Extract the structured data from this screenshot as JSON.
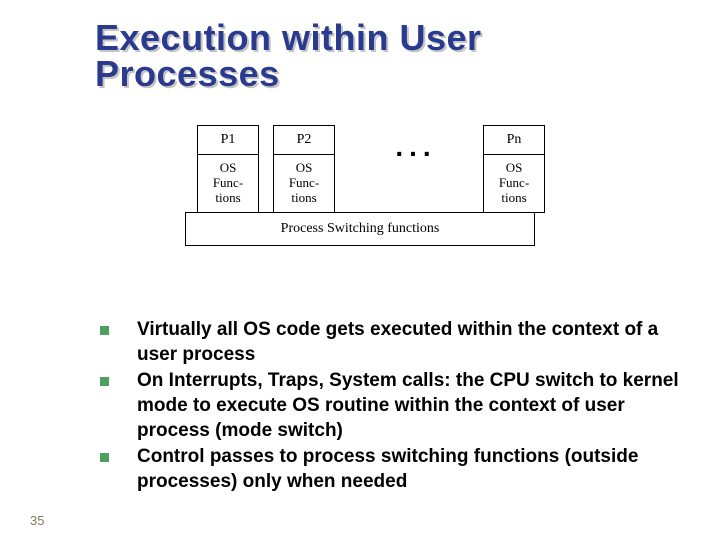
{
  "title_line1": "Execution within User",
  "title_line2": "Processes",
  "diagram": {
    "p1": "P1",
    "p2": "P2",
    "pn": "Pn",
    "ellipsis": "...",
    "os_line1": "OS",
    "os_line2": "Func-",
    "os_line3": "tions",
    "switch_label": "Process Switching functions"
  },
  "bullets": [
    "Virtually all OS code gets executed within the context of a user process",
    "On Interrupts, Traps, System calls: the CPU switch to kernel mode to execute OS routine within the context of user process (mode switch)",
    "Control passes to process switching functions (outside processes) only when needed"
  ],
  "page_number": "35"
}
